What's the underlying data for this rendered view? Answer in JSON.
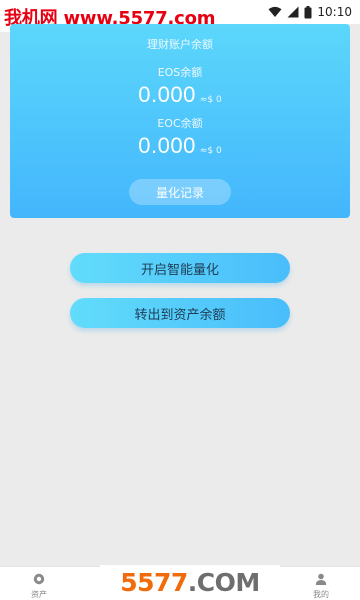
{
  "status_bar": {
    "watermark": "我机网 www.5577.com",
    "time": "10:10"
  },
  "card": {
    "title": "理财账户余额",
    "eos": {
      "label": "EOS余额",
      "value": "0.000",
      "unit": "≈$ 0"
    },
    "eoc": {
      "label": "EOC余额",
      "value": "0.000",
      "unit": "≈$ 0"
    },
    "record_button": "量化记录"
  },
  "actions": {
    "start_label": "开启智能量化",
    "transfer_label": "转出到资产余额"
  },
  "bottom_nav": {
    "assets_label": "资产",
    "mine_label": "我的"
  },
  "watermark_bottom": {
    "number": "5577",
    "domain": ".COM"
  },
  "colors": {
    "card_top": "#5cd7fb",
    "card_bottom": "#43b6fc",
    "button_left": "#62dcfb",
    "button_right": "#49bdfb",
    "watermark_red": "#e60012",
    "watermark_orange": "#f26b0a"
  }
}
